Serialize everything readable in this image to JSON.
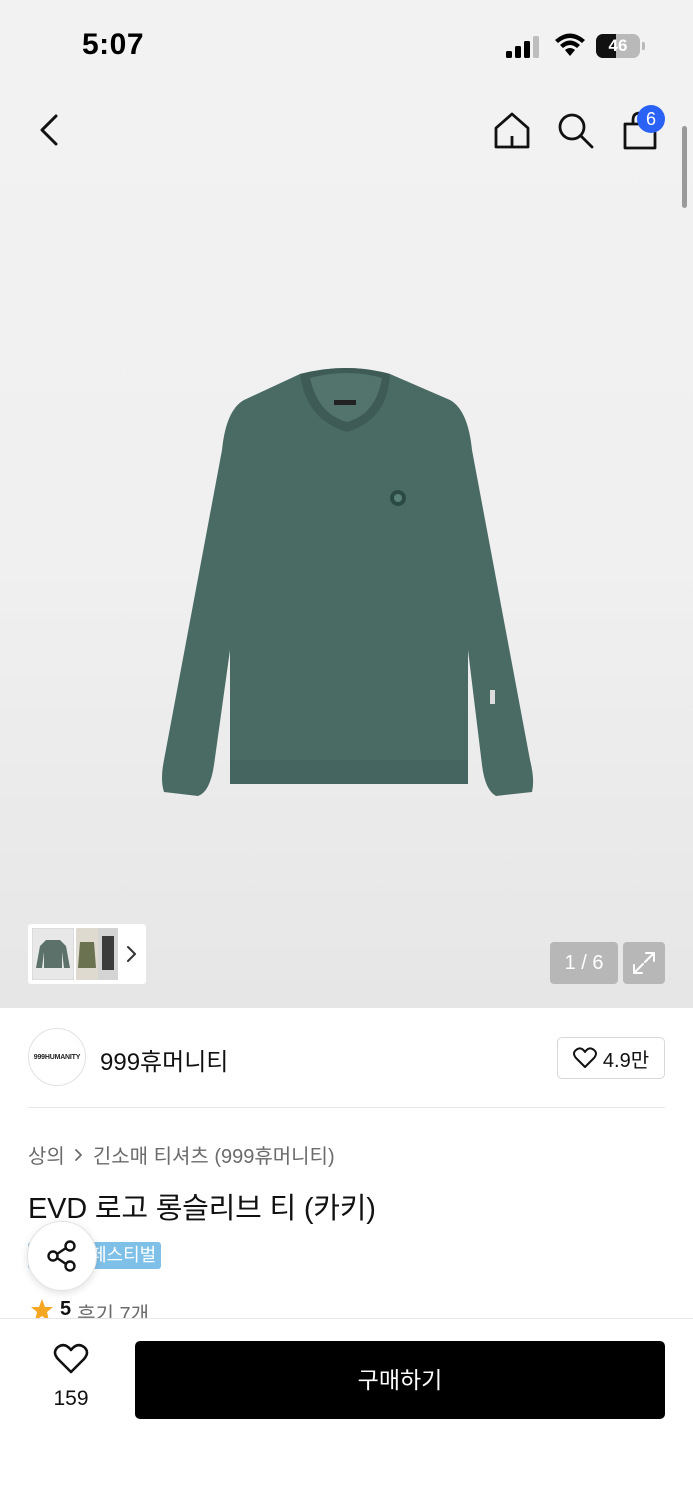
{
  "status_bar": {
    "time": "5:07",
    "battery": "46",
    "battery_level": 0.46
  },
  "header": {
    "cart_count": "6"
  },
  "gallery": {
    "counter": "1 / 6"
  },
  "brand": {
    "name": "999휴머니티",
    "logo_text": "999HUMANITY",
    "likes": "4.9만"
  },
  "breadcrumb": {
    "category": "상의",
    "subcategory": "긴소매 티셔츠 (999휴머니티)"
  },
  "product": {
    "title": "EVD 로고 롱슬리브 티 (카키)",
    "tag": "페스티벌",
    "rating": "5",
    "reviews": "후기 7개"
  },
  "bottom": {
    "wish_count": "159",
    "buy_label": "구매하기"
  },
  "colors": {
    "accent_badge": "#2a62f5",
    "tag_bg": "#7ec0e8",
    "shirt": "#4a6b63",
    "buy_bg": "#000000"
  }
}
